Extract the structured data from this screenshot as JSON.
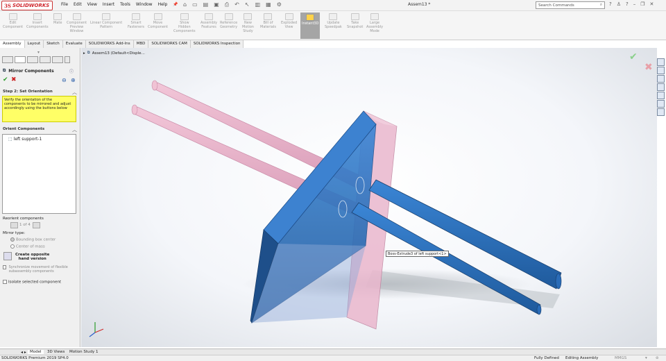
{
  "app": {
    "logo_ds": "3S",
    "logo_text": "SOLIDWORKS",
    "document_title": "Assem13 *",
    "menu": [
      "File",
      "Edit",
      "View",
      "Insert",
      "Tools",
      "Window",
      "Help"
    ],
    "search_placeholder": "Search Commands",
    "brand_color": "#d0262d"
  },
  "ribbon": {
    "buttons": [
      {
        "label": "Edit\nComponent"
      },
      {
        "label": "Insert\nComponents"
      },
      {
        "label": "Mate"
      },
      {
        "label": "Component\nPreview\nWindow"
      },
      {
        "label": "Linear Component\nPattern"
      },
      {
        "label": "Smart\nFasteners"
      },
      {
        "label": "Move\nComponent"
      },
      {
        "label": "Show\nHidden\nComponents"
      },
      {
        "label": "Assembly\nFeatures"
      },
      {
        "label": "Reference\nGeometry"
      },
      {
        "label": "New\nMotion\nStudy"
      },
      {
        "label": "Bill of\nMaterials"
      },
      {
        "label": "Exploded\nView"
      },
      {
        "label": "Instant3D"
      },
      {
        "label": "Update\nSpeedpak"
      },
      {
        "label": "Take\nSnapshot"
      },
      {
        "label": "Large\nAssembly\nMode"
      }
    ]
  },
  "tabs": [
    "Assembly",
    "Layout",
    "Sketch",
    "Evaluate",
    "SOLIDWORKS Add-Ins",
    "MBD",
    "SOLIDWORKS CAM",
    "SOLIDWORKS Inspection"
  ],
  "panel": {
    "title": "Mirror Components",
    "step_heading": "Step 2: Set Orientation",
    "message": "Verify the orientation of the components to be mirrored and adjust accordingly using the buttons below",
    "orient_heading": "Orient Components",
    "orient_item": "left support-1",
    "reorient_label": "Reorient components",
    "reorient_counter": "1 of 4",
    "mirror_type_label": "Mirror type:",
    "radio_bounding": "Bounding box center",
    "radio_mass": "Center of mass",
    "create_opposite": "Create opposite\nhand version",
    "sync_label": "Synchronize movement of flexible subassembly components",
    "isolate_label": "Isolate selected component"
  },
  "viewport": {
    "tree_item": "Assem13 (Default<Disple...",
    "tooltip": "Boss-Extrude3 of left support<1>",
    "pink": "#e7b0c8",
    "blue": "#2e75c8",
    "blue_dark": "#1e4f8a"
  },
  "bottom_tabs": [
    "Model",
    "3D Views",
    "Motion Study 1"
  ],
  "status": {
    "left": "SOLIDWORKS Premium 2019 SP4.0",
    "defined": "Fully Defined",
    "editing": "Editing Assembly",
    "units": "MMGS"
  }
}
